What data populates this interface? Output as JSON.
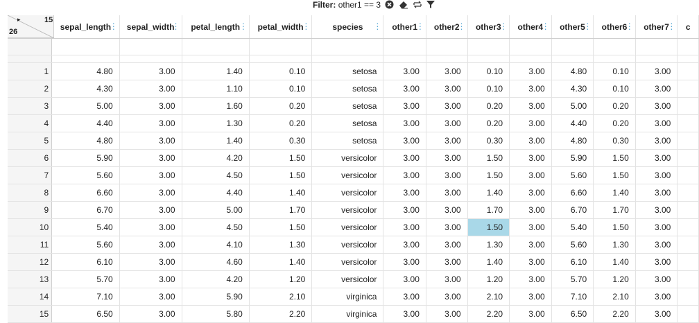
{
  "filter": {
    "label": "Filter:",
    "expression": "other1 == 3",
    "icons": [
      "clear-filter-icon",
      "eraser-icon",
      "swap-icon",
      "funnel-icon"
    ]
  },
  "corner": {
    "play": "▸",
    "column_count": "15",
    "row_count": "26"
  },
  "columns": [
    "sepal_length",
    "sepal_width",
    "petal_length",
    "petal_width",
    "species",
    "other1",
    "other2",
    "other3",
    "other4",
    "other5",
    "other6",
    "other7",
    "c"
  ],
  "rows": [
    {
      "idx": "1",
      "cells": [
        "4.80",
        "3.00",
        "1.40",
        "0.10",
        "setosa",
        "3.00",
        "3.00",
        "0.10",
        "3.00",
        "4.80",
        "0.10",
        "3.00",
        ""
      ]
    },
    {
      "idx": "2",
      "cells": [
        "4.30",
        "3.00",
        "1.10",
        "0.10",
        "setosa",
        "3.00",
        "3.00",
        "0.10",
        "3.00",
        "4.30",
        "0.10",
        "3.00",
        ""
      ]
    },
    {
      "idx": "3",
      "cells": [
        "5.00",
        "3.00",
        "1.60",
        "0.20",
        "setosa",
        "3.00",
        "3.00",
        "0.20",
        "3.00",
        "5.00",
        "0.20",
        "3.00",
        ""
      ]
    },
    {
      "idx": "4",
      "cells": [
        "4.40",
        "3.00",
        "1.30",
        "0.20",
        "setosa",
        "3.00",
        "3.00",
        "0.20",
        "3.00",
        "4.40",
        "0.20",
        "3.00",
        ""
      ]
    },
    {
      "idx": "5",
      "cells": [
        "4.80",
        "3.00",
        "1.40",
        "0.30",
        "setosa",
        "3.00",
        "3.00",
        "0.30",
        "3.00",
        "4.80",
        "0.30",
        "3.00",
        ""
      ]
    },
    {
      "idx": "6",
      "cells": [
        "5.90",
        "3.00",
        "4.20",
        "1.50",
        "versicolor",
        "3.00",
        "3.00",
        "1.50",
        "3.00",
        "5.90",
        "1.50",
        "3.00",
        ""
      ]
    },
    {
      "idx": "7",
      "cells": [
        "5.60",
        "3.00",
        "4.50",
        "1.50",
        "versicolor",
        "3.00",
        "3.00",
        "1.50",
        "3.00",
        "5.60",
        "1.50",
        "3.00",
        ""
      ]
    },
    {
      "idx": "8",
      "cells": [
        "6.60",
        "3.00",
        "4.40",
        "1.40",
        "versicolor",
        "3.00",
        "3.00",
        "1.40",
        "3.00",
        "6.60",
        "1.40",
        "3.00",
        ""
      ]
    },
    {
      "idx": "9",
      "cells": [
        "6.70",
        "3.00",
        "5.00",
        "1.70",
        "versicolor",
        "3.00",
        "3.00",
        "1.70",
        "3.00",
        "6.70",
        "1.70",
        "3.00",
        ""
      ]
    },
    {
      "idx": "10",
      "cells": [
        "5.40",
        "3.00",
        "4.50",
        "1.50",
        "versicolor",
        "3.00",
        "3.00",
        "1.50",
        "3.00",
        "5.40",
        "1.50",
        "3.00",
        ""
      ]
    },
    {
      "idx": "11",
      "cells": [
        "5.60",
        "3.00",
        "4.10",
        "1.30",
        "versicolor",
        "3.00",
        "3.00",
        "1.30",
        "3.00",
        "5.60",
        "1.30",
        "3.00",
        ""
      ]
    },
    {
      "idx": "12",
      "cells": [
        "6.10",
        "3.00",
        "4.60",
        "1.40",
        "versicolor",
        "3.00",
        "3.00",
        "1.40",
        "3.00",
        "6.10",
        "1.40",
        "3.00",
        ""
      ]
    },
    {
      "idx": "13",
      "cells": [
        "5.70",
        "3.00",
        "4.20",
        "1.20",
        "versicolor",
        "3.00",
        "3.00",
        "1.20",
        "3.00",
        "5.70",
        "1.20",
        "3.00",
        ""
      ]
    },
    {
      "idx": "14",
      "cells": [
        "7.10",
        "3.00",
        "5.90",
        "2.10",
        "virginica",
        "3.00",
        "3.00",
        "2.10",
        "3.00",
        "7.10",
        "2.10",
        "3.00",
        ""
      ]
    },
    {
      "idx": "15",
      "cells": [
        "6.50",
        "3.00",
        "5.80",
        "2.20",
        "virginica",
        "3.00",
        "3.00",
        "2.20",
        "3.00",
        "6.50",
        "2.20",
        "3.00",
        ""
      ]
    }
  ],
  "selected_cell": {
    "row": "10",
    "column": "other3",
    "color": "#a9d8e8"
  },
  "accent_color": "#5aa9d6"
}
